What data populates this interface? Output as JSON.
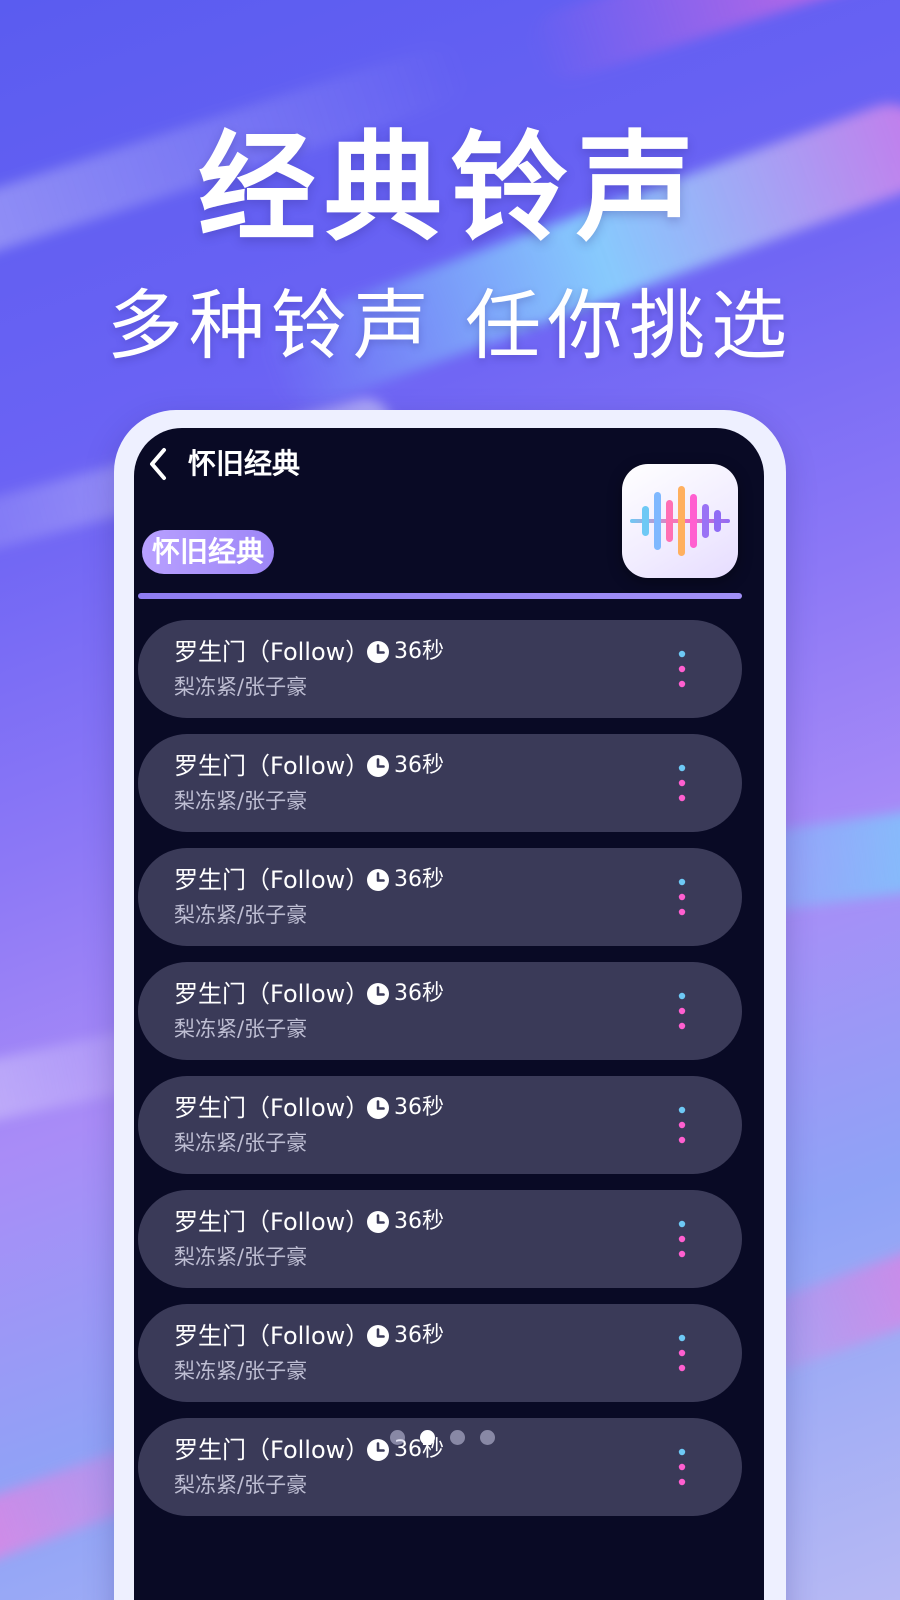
{
  "promo": {
    "headline": "经典铃声",
    "subheadline": "多种铃声 任你挑选"
  },
  "screen": {
    "nav": {
      "back_icon": "chevron-left-icon",
      "title": "怀旧经典"
    },
    "app_icon": "waveform-icon",
    "category_tag": "怀旧经典",
    "tracks": [
      {
        "title": "罗生门（Follow）",
        "duration": "36秒",
        "artist": "梨冻紧/张子豪"
      },
      {
        "title": "罗生门（Follow）",
        "duration": "36秒",
        "artist": "梨冻紧/张子豪"
      },
      {
        "title": "罗生门（Follow）",
        "duration": "36秒",
        "artist": "梨冻紧/张子豪"
      },
      {
        "title": "罗生门（Follow）",
        "duration": "36秒",
        "artist": "梨冻紧/张子豪"
      },
      {
        "title": "罗生门（Follow）",
        "duration": "36秒",
        "artist": "梨冻紧/张子豪"
      },
      {
        "title": "罗生门（Follow）",
        "duration": "36秒",
        "artist": "梨冻紧/张子豪"
      },
      {
        "title": "罗生门（Follow）",
        "duration": "36秒",
        "artist": "梨冻紧/张子豪"
      },
      {
        "title": "罗生门（Follow）",
        "duration": "36秒",
        "artist": "梨冻紧/张子豪"
      }
    ]
  },
  "carousel": {
    "page_count": 4,
    "active_index": 1
  },
  "colors": {
    "screen_background": "#090a25",
    "row_background": "#3a3a58",
    "accent": "#9d86f7",
    "dot_blue": "#6ec9f5",
    "dot_pink": "#ff5fd0"
  }
}
